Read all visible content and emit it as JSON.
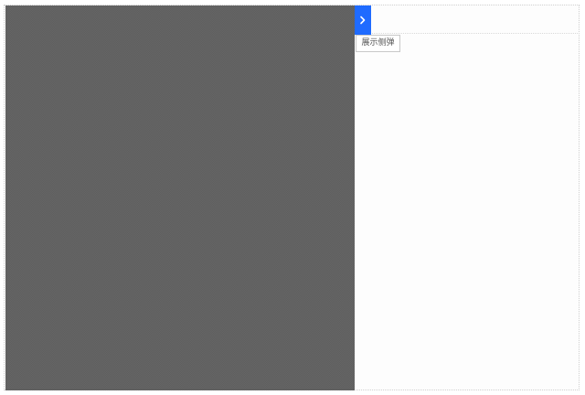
{
  "panel": {
    "show_button_label": "展示侧弹"
  },
  "toggle_tab": {
    "icon": "chevron-right-icon"
  },
  "colors": {
    "accent": "#1f6bff",
    "overlay": "#656565",
    "panel_background": "#fdfdfd",
    "button_border": "#c8c8c8",
    "button_text": "#555555"
  }
}
